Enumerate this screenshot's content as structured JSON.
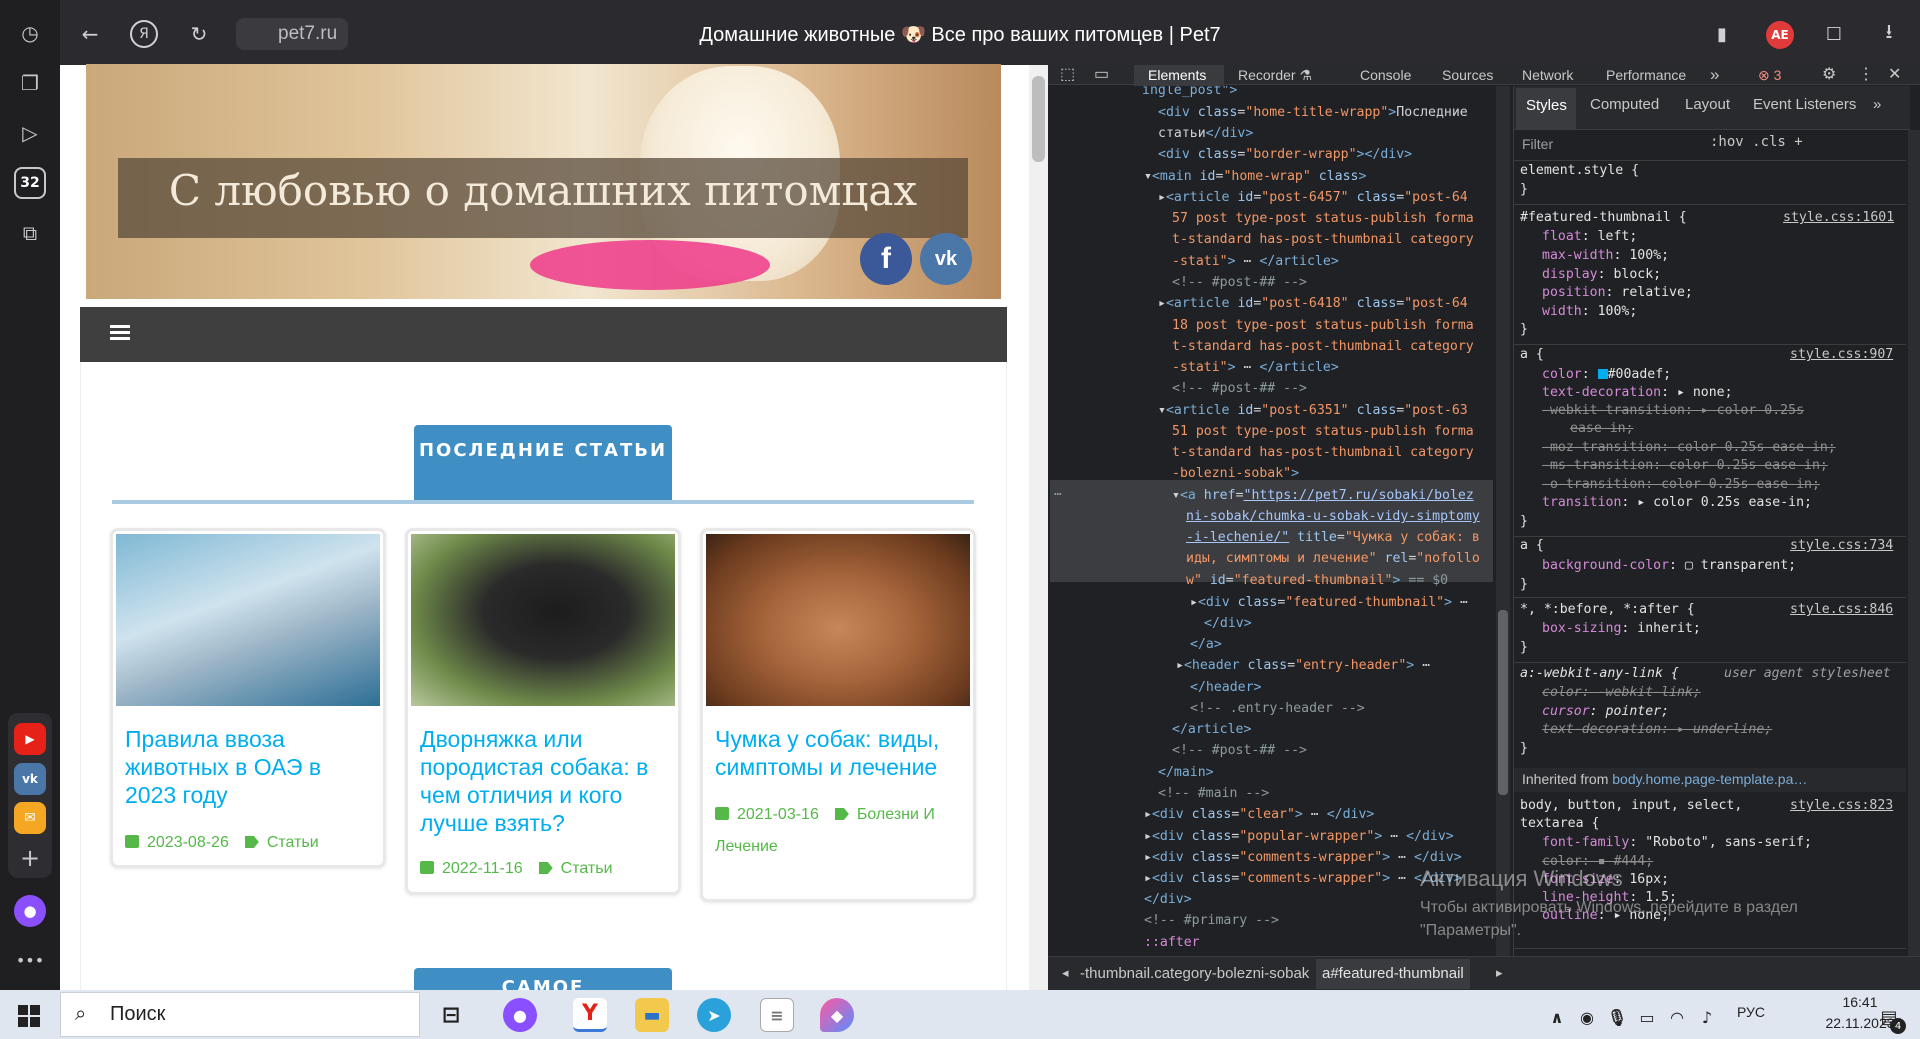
{
  "browser": {
    "url": "pet7.ru",
    "title": "Домашние животные 🐶 Все про ваших питомцев | Pet7",
    "ext_badge": "AE",
    "sidebar_badge": "32"
  },
  "site": {
    "banner_text": "С любовью о домашних питомцах",
    "fb_label": "f",
    "vk_label": "vk",
    "section1": "ПОСЛЕДНИЕ СТАТЬИ",
    "section2": "САМОЕ",
    "cards": [
      {
        "title": "Правила ввоза животных в ОАЭ в 2023 году",
        "date": "2023-08-26",
        "category": "Статьи"
      },
      {
        "title": "Дворняжка или породистая собака: в чем отличия и кого лучше взять?",
        "date": "2022-11-16",
        "category": "Статьи"
      },
      {
        "title": "Чумка у собак: виды, симптомы и лечение",
        "date": "2021-03-16",
        "category": "Болезни И Лечение"
      }
    ]
  },
  "devtools": {
    "tabs": [
      "Elements",
      "Recorder ⚗",
      "Console",
      "Sources",
      "Network",
      "Performance"
    ],
    "more": "»",
    "errors": "3",
    "styles_tabs": [
      "Styles",
      "Computed",
      "Layout",
      "Event Listeners"
    ],
    "filter_placeholder": "Filter",
    "filter_tools": ":hov  .cls  +",
    "inherited_from": "Inherited from",
    "inherited_sel": "body.home.page-template.pa…",
    "crumb1": "-thumbnail.category-bolezni-sobak",
    "crumb2": "a#featured-thumbnail",
    "watermark_title": "Активация Windows",
    "watermark_text": "Чтобы активировать Windows, перейдите в раздел \"Параметры\"."
  },
  "taskbar": {
    "search": "Поиск",
    "lang": "РУС",
    "time": "16:41",
    "date": "22.11.2023",
    "notif": "4"
  }
}
